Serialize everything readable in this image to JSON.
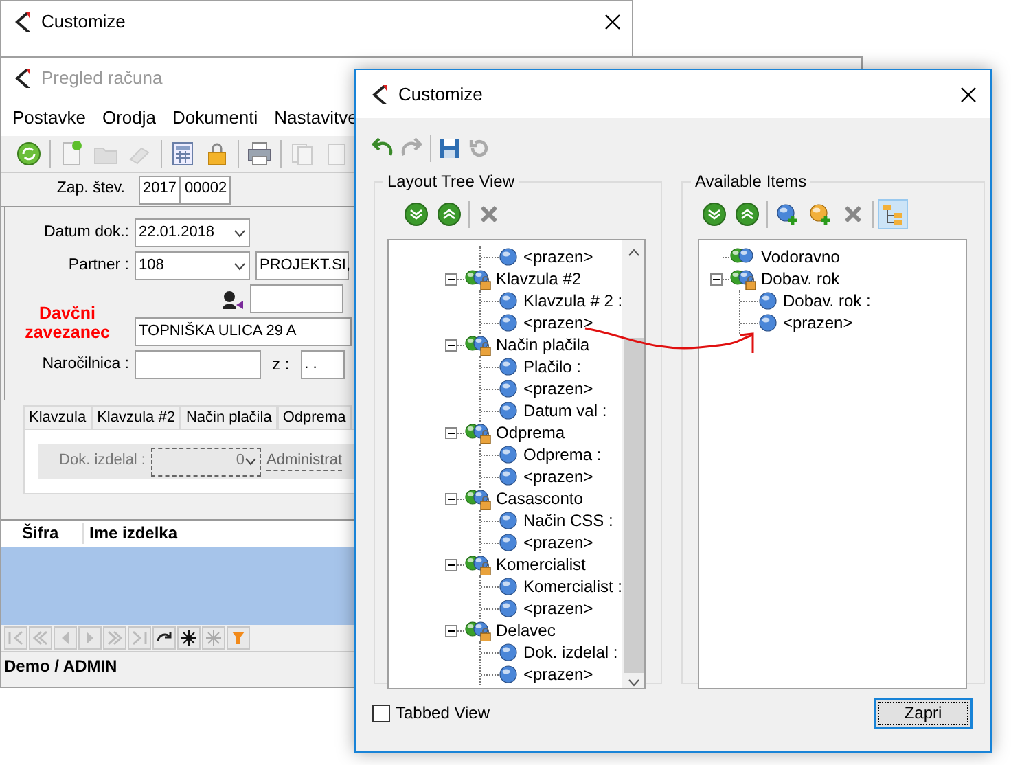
{
  "back_window": {
    "title": "Customize"
  },
  "invoice_window": {
    "title": "Pregled računa",
    "menu": [
      "Postavke",
      "Orodja",
      "Dokumenti",
      "Nastavitve"
    ],
    "record_no": {
      "label": "Zap. štev.",
      "year": "2017",
      "number": "00002"
    },
    "doc_date": {
      "label": "Datum dok.:",
      "value": "22.01.2018"
    },
    "partner": {
      "label": "Partner :",
      "code": "108",
      "name": "PROJEKT.SI,"
    },
    "tax_payer_label": "Davčni zavezanec",
    "address": "TOPNIŠKA ULICA 29 A",
    "order": {
      "label": "Naročilnica :",
      "z_label": "z :",
      "date_value": ". ."
    },
    "tabs": [
      {
        "label": "Klavzula",
        "selected": false
      },
      {
        "label": "Klavzula #2",
        "selected": false
      },
      {
        "label": "Način plačila",
        "selected": false
      },
      {
        "label": "Odprema",
        "selected": false
      }
    ],
    "made_by": {
      "label": "Dok. izdelal :",
      "value": "0",
      "name": "Administrat"
    },
    "grid": {
      "columns": [
        "Šifra",
        "Ime izdelka"
      ]
    },
    "status_bar": "Demo / ADMIN"
  },
  "dialog": {
    "title": "Customize",
    "layout_tree": {
      "label": "Layout Tree View",
      "nodes": [
        {
          "kind": "group",
          "children": [
            {
              "kind": "item",
              "label": "<prazen>"
            }
          ]
        },
        {
          "kind": "group",
          "label": "Klavzula #2",
          "locked": true,
          "expanded": true,
          "children": [
            {
              "kind": "item",
              "label": "Klavzula # 2 :"
            },
            {
              "kind": "item",
              "label": "<prazen>"
            }
          ]
        },
        {
          "kind": "group",
          "label": "Način plačila",
          "locked": true,
          "expanded": true,
          "children": [
            {
              "kind": "item",
              "label": "Plačilo :"
            },
            {
              "kind": "item",
              "label": "<prazen>"
            },
            {
              "kind": "item",
              "label": "Datum val :"
            }
          ]
        },
        {
          "kind": "group",
          "label": "Odprema",
          "locked": true,
          "expanded": true,
          "children": [
            {
              "kind": "item",
              "label": "Odprema :"
            },
            {
              "kind": "item",
              "label": "<prazen>"
            }
          ]
        },
        {
          "kind": "group",
          "label": "Casasconto",
          "locked": true,
          "expanded": true,
          "children": [
            {
              "kind": "item",
              "label": "Način CSS :"
            },
            {
              "kind": "item",
              "label": "<prazen>"
            }
          ]
        },
        {
          "kind": "group",
          "label": "Komercialist",
          "locked": true,
          "expanded": true,
          "children": [
            {
              "kind": "item",
              "label": "Komercialist :"
            },
            {
              "kind": "item",
              "label": "<prazen>"
            }
          ]
        },
        {
          "kind": "group",
          "label": "Delavec",
          "locked": true,
          "expanded": true,
          "children": [
            {
              "kind": "item",
              "label": "Dok. izdelal :"
            },
            {
              "kind": "item",
              "label": "<prazen>"
            }
          ]
        }
      ]
    },
    "available_items": {
      "label": "Available Items",
      "tree_view_on": true,
      "nodes": [
        {
          "kind": "group",
          "label": "Vodoravno",
          "locked": false
        },
        {
          "kind": "group",
          "label": "Dobav. rok",
          "locked": true,
          "expanded": true,
          "children": [
            {
              "kind": "item",
              "label": "Dobav. rok :"
            },
            {
              "kind": "item",
              "label": "<prazen>"
            }
          ]
        }
      ]
    },
    "tabbed_view": {
      "label": "Tabbed View",
      "checked": false
    },
    "close_button": "Zapri"
  }
}
